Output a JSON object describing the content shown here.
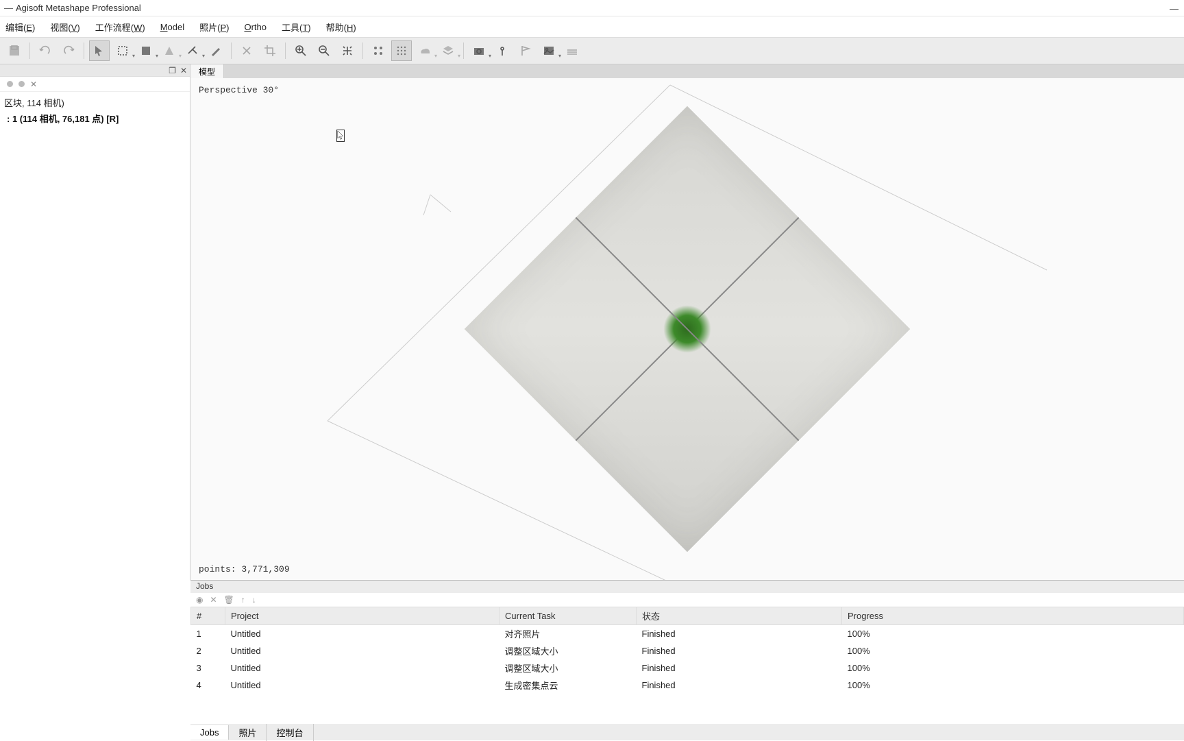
{
  "window": {
    "title": "Agisoft Metashape Professional"
  },
  "menu": {
    "edit": "编辑(E)",
    "view": "视图(V)",
    "workflow": "工作流程(W)",
    "model": "Model",
    "photo": "照片(P)",
    "ortho": "Ortho",
    "tools": "工具(T)",
    "help": "帮助(H)"
  },
  "sidebar": {
    "line1": "区块, 114 相机)",
    "line2": "1 (114 相机, 76,181 点) [R]"
  },
  "viewport": {
    "tab": "模型",
    "perspective": "Perspective 30°",
    "points": "points: 3,771,309"
  },
  "jobs": {
    "title": "Jobs",
    "headers": {
      "num": "#",
      "project": "Project",
      "task": "Current Task",
      "status": "状态",
      "progress": "Progress"
    },
    "rows": [
      {
        "num": "1",
        "project": "Untitled",
        "task": "对齐照片",
        "status": "Finished",
        "progress": "100%"
      },
      {
        "num": "2",
        "project": "Untitled",
        "task": "调整区域大小",
        "status": "Finished",
        "progress": "100%"
      },
      {
        "num": "3",
        "project": "Untitled",
        "task": "调整区域大小",
        "status": "Finished",
        "progress": "100%"
      },
      {
        "num": "4",
        "project": "Untitled",
        "task": "生成密集点云",
        "status": "Finished",
        "progress": "100%"
      }
    ]
  },
  "bottom_tabs": {
    "jobs": "Jobs",
    "photos": "照片",
    "console": "控制台"
  }
}
